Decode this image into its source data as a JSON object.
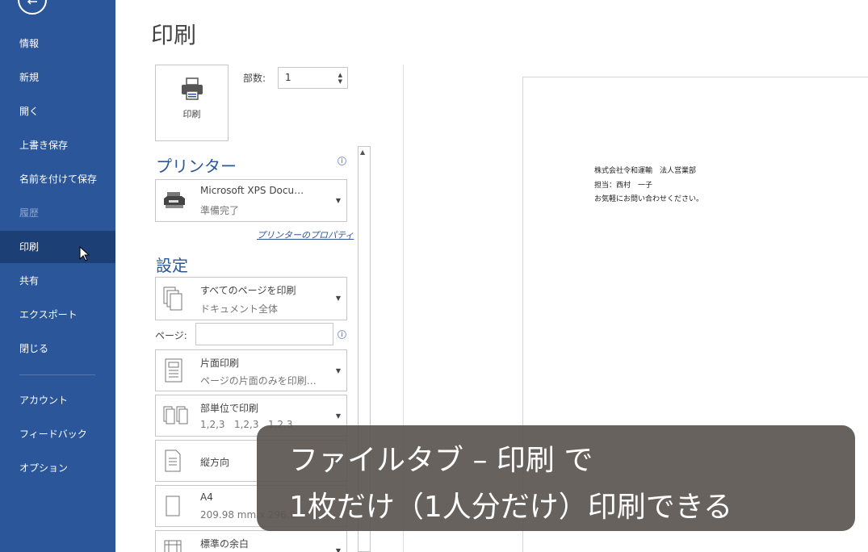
{
  "sidebar": {
    "items": [
      {
        "label": "情報"
      },
      {
        "label": "新規"
      },
      {
        "label": "開く"
      },
      {
        "label": "上書き保存"
      },
      {
        "label": "名前を付けて保存"
      },
      {
        "label": "履歴"
      },
      {
        "label": "印刷"
      },
      {
        "label": "共有"
      },
      {
        "label": "エクスポート"
      },
      {
        "label": "閉じる"
      },
      {
        "label": "アカウント"
      },
      {
        "label": "フィードバック"
      },
      {
        "label": "オプション"
      }
    ],
    "active": "印刷",
    "disabled": "履歴"
  },
  "page_title": "印刷",
  "print_button_label": "印刷",
  "copies": {
    "label": "部数:",
    "value": "1"
  },
  "printer": {
    "heading": "プリンター",
    "name": "Microsoft XPS Docu…",
    "status": "準備完了",
    "properties_link": "プリンターのプロパティ"
  },
  "settings": {
    "heading": "設定",
    "scope": {
      "line1": "すべてのページを印刷",
      "line2": "ドキュメント全体"
    },
    "pages_label": "ページ:",
    "pages_value": "",
    "sides": {
      "line1": "片面印刷",
      "line2": "ページの片面のみを印刷…"
    },
    "collate": {
      "line1": "部単位で印刷",
      "line2": "1,2,3   1,2,3   1,2,3"
    },
    "orientation": {
      "line1": "縦方向"
    },
    "paper": {
      "line1": "A4",
      "line2": "209.98 mm x 296.9"
    },
    "margins": {
      "line1": "標準の余白"
    }
  },
  "preview": {
    "lines": [
      "株式会社令和運輸　法人営業部",
      "担当：西村　一子",
      "お気軽にお問い合わせください。"
    ]
  },
  "caption": {
    "line1": "ファイルタブ – 印刷 で",
    "line2": "1枚だけ（1人分だけ）印刷できる"
  },
  "colors": {
    "accent": "#2b579a",
    "caption_bg": "#5c5652"
  }
}
